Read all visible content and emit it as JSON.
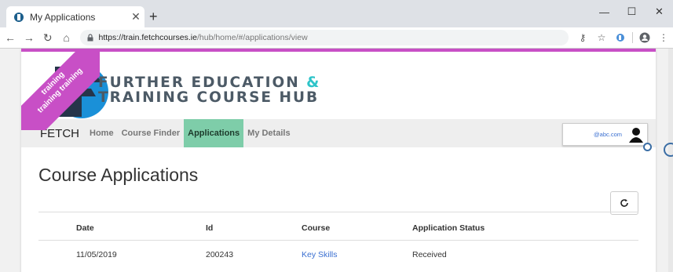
{
  "browser": {
    "tab_title": "My Applications",
    "url_host": "https://train.fetchcourses.ie",
    "url_path": "/hub/home/#/applications/view"
  },
  "ribbon": {
    "lines": [
      "training",
      "training training"
    ]
  },
  "brand": {
    "line1": "FURTHER EDUCATION",
    "amp": "&",
    "line2": "TRAINING COURSE HUB"
  },
  "nav": {
    "brand": "FETCH",
    "links": [
      "Home",
      "Course Finder",
      "Applications",
      "My Details"
    ],
    "active": "Applications"
  },
  "user": {
    "email": "@abc.com"
  },
  "page": {
    "title": "Course Applications"
  },
  "table": {
    "headers": [
      "Date",
      "Id",
      "Course",
      "Application Status"
    ],
    "rows": [
      {
        "date": "11/05/2019",
        "id": "200243",
        "course": "Key Skills",
        "status": "Received"
      }
    ]
  },
  "colors": {
    "accent_pink": "#c84fc6",
    "active_nav": "#7ecda9",
    "brand_text": "#4c5a66",
    "link_blue": "#3a6fd1"
  },
  "icons": [
    "favicon-icon",
    "close-icon",
    "plus-icon",
    "back-icon",
    "forward-icon",
    "reload-icon",
    "home-icon",
    "lock-icon",
    "key-icon",
    "star-icon",
    "extension-icon",
    "profile-icon",
    "menu-icon",
    "user-avatar-icon",
    "refresh-icon"
  ]
}
